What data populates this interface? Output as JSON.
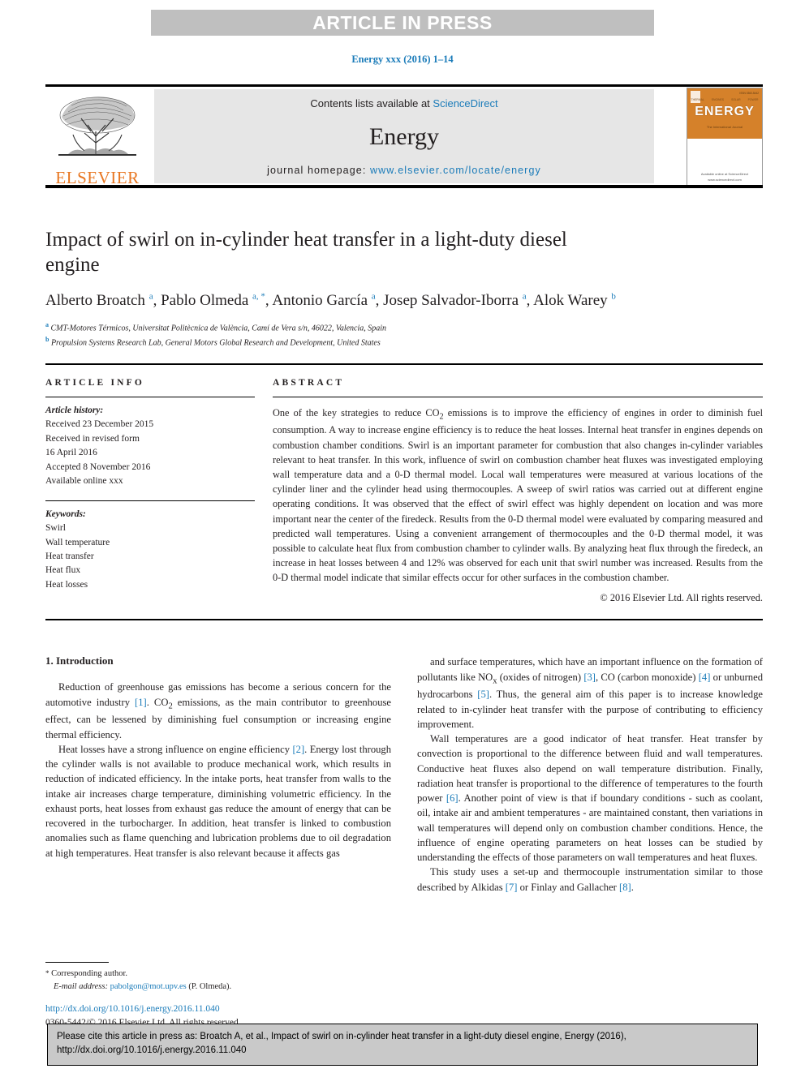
{
  "banner": {
    "text": "ARTICLE IN PRESS"
  },
  "running_head": "Energy xxx (2016) 1–14",
  "masthead": {
    "contents_prefix": "Contents lists available at ",
    "sciencedirect": "ScienceDirect",
    "journal_name": "Energy",
    "homepage_prefix": "journal homepage: ",
    "homepage_url": "www.elsevier.com/locate/energy",
    "publisher_logo_word": "ELSEVIER",
    "cover": {
      "title": "ENERGY",
      "tagline": "The International Journal",
      "issn": "ISSN 0360-5442",
      "topics": [
        "THERMAL",
        "ENGINES",
        "SOLAR",
        "POWER"
      ],
      "footer": "Available online at\nScienceDirect\nwww.sciencedirect.com"
    }
  },
  "article": {
    "title": "Impact of swirl on in-cylinder heat transfer in a light-duty diesel engine",
    "authors_html": "Alberto Broatch <sup>a</sup>, Pablo Olmeda <sup>a, *</sup>, Antonio García <sup>a</sup>, Josep Salvador-Iborra <sup>a</sup>, Alok Warey <sup>b</sup>",
    "affiliations": [
      {
        "marker": "a",
        "text": "CMT-Motores Térmicos, Universitat Politècnica de València, Camí de Vera s/n, 46022, Valencia, Spain"
      },
      {
        "marker": "b",
        "text": "Propulsion Systems Research Lab, General Motors Global Research and Development, United States"
      }
    ]
  },
  "article_info": {
    "label": "ARTICLE INFO",
    "history_heading": "Article history:",
    "history": [
      "Received 23 December 2015",
      "Received in revised form",
      "16 April 2016",
      "Accepted 8 November 2016",
      "Available online xxx"
    ],
    "keywords_heading": "Keywords:",
    "keywords": [
      "Swirl",
      "Wall temperature",
      "Heat transfer",
      "Heat flux",
      "Heat losses"
    ]
  },
  "abstract": {
    "label": "ABSTRACT",
    "text": "One of the key strategies to reduce CO2 emissions is to improve the efficiency of engines in order to diminish fuel consumption. A way to increase engine efficiency is to reduce the heat losses. Internal heat transfer in engines depends on combustion chamber conditions. Swirl is an important parameter for combustion that also changes in-cylinder variables relevant to heat transfer. In this work, influence of swirl on combustion chamber heat fluxes was investigated employing wall temperature data and a 0-D thermal model. Local wall temperatures were measured at various locations of the cylinder liner and the cylinder head using thermocouples. A sweep of swirl ratios was carried out at different engine operating conditions. It was observed that the effect of swirl effect was highly dependent on location and was more important near the center of the firedeck. Results from the 0-D thermal model were evaluated by comparing measured and predicted wall temperatures. Using a convenient arrangement of thermocouples and the 0-D thermal model, it was possible to calculate heat flux from combustion chamber to cylinder walls. By analyzing heat flux through the firedeck, an increase in heat losses between 4 and 12% was observed for each unit that swirl number was increased. Results from the 0-D thermal model indicate that similar effects occur for other surfaces in the combustion chamber.",
    "copyright": "© 2016 Elsevier Ltd. All rights reserved."
  },
  "introduction": {
    "heading": "1. Introduction",
    "left_paragraphs": [
      "Reduction of greenhouse gas emissions has become a serious concern for the automotive industry [1]. CO2 emissions, as the main contributor to greenhouse effect, can be lessened by diminishing fuel consumption or increasing engine thermal efficiency.",
      "Heat losses have a strong influence on engine efficiency [2]. Energy lost through the cylinder walls is not available to produce mechanical work, which results in reduction of indicated efficiency. In the intake ports, heat transfer from walls to the intake air increases charge temperature, diminishing volumetric efficiency. In the exhaust ports, heat losses from exhaust gas reduce the amount of energy that can be recovered in the turbocharger. In addition, heat transfer is linked to combustion anomalies such as flame quenching and lubrication problems due to oil degradation at high temperatures. Heat transfer is also relevant because it affects gas"
    ],
    "right_paragraphs": [
      "and surface temperatures, which have an important influence on the formation of pollutants like NOx (oxides of nitrogen) [3], CO (carbon monoxide) [4] or unburned hydrocarbons [5]. Thus, the general aim of this paper is to increase knowledge related to in-cylinder heat transfer with the purpose of contributing to efficiency improvement.",
      "Wall temperatures are a good indicator of heat transfer. Heat transfer by convection is proportional to the difference between fluid and wall temperatures. Conductive heat fluxes also depend on wall temperature distribution. Finally, radiation heat transfer is proportional to the difference of temperatures to the fourth power [6]. Another point of view is that if boundary conditions - such as coolant, oil, intake air and ambient temperatures - are maintained constant, then variations in wall temperatures will depend only on combustion chamber conditions. Hence, the influence of engine operating parameters on heat losses can be studied by understanding the effects of those parameters on wall temperatures and heat fluxes.",
      "This study uses a set-up and thermocouple instrumentation similar to those described by Alkidas [7] or Finlay and Gallacher [8]."
    ]
  },
  "footnote": {
    "corresponding": "Corresponding author.",
    "email_label": "E-mail address:",
    "email": "pabolgon@mot.upv.es",
    "email_owner": "(P. Olmeda)."
  },
  "doi_block": {
    "doi_url": "http://dx.doi.org/10.1016/j.energy.2016.11.040",
    "issn_line": "0360-5442/© 2016 Elsevier Ltd. All rights reserved."
  },
  "cite_box": {
    "text": "Please cite this article in press as: Broatch A, et al., Impact of swirl on in-cylinder heat transfer in a light-duty diesel engine, Energy (2016), http://dx.doi.org/10.1016/j.energy.2016.11.040"
  },
  "colors": {
    "link_blue": "#1a7bb9",
    "elsevier_orange": "#e87722",
    "banner_gray": "#bfbfbf",
    "masthead_gray": "#e6e6e6",
    "cite_gray": "#c9c9c9"
  }
}
